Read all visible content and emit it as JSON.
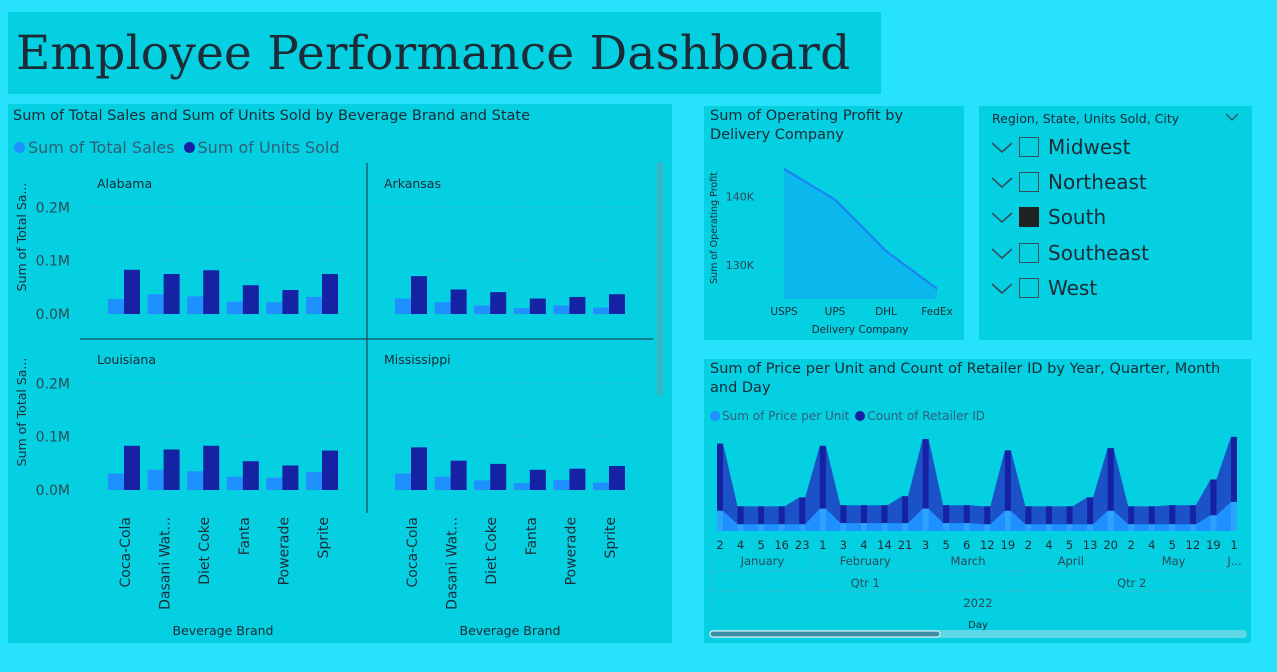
{
  "page": {
    "title": "Employee Performance Dashboard"
  },
  "colors": {
    "background": "#26e2fb",
    "panel": "#04d0e2",
    "total_sales": "#1e90ff",
    "units_sold": "#1422a3",
    "area_fill": "#0bb8ee",
    "area_line": "#1a84f0"
  },
  "small_multiples": {
    "title": "Sum of Total Sales and Sum of Units Sold by Beverage Brand and State",
    "legend": [
      "Sum of Total Sales",
      "Sum of Units Sold"
    ],
    "ylabel": "Sum of Total Sa...",
    "xlabel": "Beverage Brand",
    "x_tick_labels": [
      "Coca-Cola",
      "Dasani Wat...",
      "Diet Coke",
      "Fanta",
      "Powerade",
      "Sprite"
    ],
    "y_tick_labels": [
      "0.0M",
      "0.1M",
      "0.2M"
    ]
  },
  "profit": {
    "title": "Sum of Operating Profit by Delivery Company",
    "ylabel": "Sum of Operating Profit",
    "xlabel": "Delivery Company",
    "y_tick_labels": [
      "140K",
      "130K"
    ]
  },
  "slicer": {
    "header": "Region, State, Units Sold, City",
    "items": [
      {
        "label": "Midwest",
        "checked": false
      },
      {
        "label": "Northeast",
        "checked": false
      },
      {
        "label": "South",
        "checked": true
      },
      {
        "label": "Southeast",
        "checked": false
      },
      {
        "label": "West",
        "checked": false
      }
    ]
  },
  "price": {
    "title": "Sum of Price per Unit and Count of Retailer ID by Year, Quarter, Month and Day",
    "legend": [
      "Sum of Price per Unit",
      "Count of Retailer ID"
    ],
    "day_labels": [
      "2",
      "4",
      "5",
      "16",
      "23",
      "1",
      "3",
      "4",
      "14",
      "21",
      "3",
      "5",
      "6",
      "12",
      "19",
      "2",
      "4",
      "5",
      "13",
      "20",
      "2",
      "4",
      "5",
      "12",
      "19",
      "1"
    ],
    "months": [
      "January",
      "February",
      "March",
      "April",
      "May",
      "J..."
    ],
    "quarters": [
      "Qtr 1",
      "Qtr 2"
    ],
    "year": "2022",
    "axis_title": "Day"
  },
  "chart_data": [
    {
      "type": "bar",
      "title": "Sum of Total Sales and Sum of Units Sold by Beverage Brand and State",
      "xlabel": "Beverage Brand",
      "ylabel": "Sum of Total Sa...",
      "ylim": [
        0,
        0.25
      ],
      "unit": "M",
      "categories": [
        "Coca-Cola",
        "Dasani Wat...",
        "Diet Coke",
        "Fanta",
        "Powerade",
        "Sprite"
      ],
      "grid": true,
      "legend": "top-left",
      "panels": [
        {
          "name": "Alabama",
          "series": [
            {
              "name": "Sum of Total Sales",
              "values": [
                0.028,
                0.037,
                0.033,
                0.023,
                0.022,
                0.032
              ]
            },
            {
              "name": "Sum of Units Sold",
              "values": [
                0.083,
                0.075,
                0.082,
                0.054,
                0.045,
                0.075
              ]
            }
          ]
        },
        {
          "name": "Arkansas",
          "series": [
            {
              "name": "Sum of Total Sales",
              "values": [
                0.029,
                0.022,
                0.016,
                0.011,
                0.016,
                0.012
              ]
            },
            {
              "name": "Sum of Units Sold",
              "values": [
                0.071,
                0.046,
                0.041,
                0.029,
                0.032,
                0.037
              ]
            }
          ]
        },
        {
          "name": "Louisiana",
          "series": [
            {
              "name": "Sum of Total Sales",
              "values": [
                0.031,
                0.038,
                0.035,
                0.025,
                0.023,
                0.034
              ]
            },
            {
              "name": "Sum of Units Sold",
              "values": [
                0.083,
                0.076,
                0.083,
                0.054,
                0.046,
                0.074
              ]
            }
          ]
        },
        {
          "name": "Mississippi",
          "series": [
            {
              "name": "Sum of Total Sales",
              "values": [
                0.031,
                0.025,
                0.018,
                0.013,
                0.019,
                0.014
              ]
            },
            {
              "name": "Sum of Units Sold",
              "values": [
                0.08,
                0.055,
                0.049,
                0.038,
                0.04,
                0.045
              ]
            }
          ]
        }
      ]
    },
    {
      "type": "area",
      "title": "Sum of Operating Profit by Delivery Company",
      "xlabel": "Delivery Company",
      "ylabel": "Sum of Operating Profit",
      "categories": [
        "USPS",
        "UPS",
        "DHL",
        "FedEx"
      ],
      "values": [
        144000,
        139500,
        132000,
        126500
      ],
      "ylim": [
        125000,
        145000
      ],
      "yticks": [
        130000,
        140000
      ],
      "grid": true
    },
    {
      "type": "area",
      "title": "Sum of Price per Unit and Count of Retailer ID by Year, Quarter, Month and Day",
      "xlabel": "Day",
      "legend": "top-left",
      "stacked": true,
      "x": [
        "2",
        "4",
        "5",
        "16",
        "23",
        "1",
        "3",
        "4",
        "14",
        "21",
        "3",
        "5",
        "6",
        "12",
        "19",
        "2",
        "4",
        "5",
        "13",
        "20",
        "2",
        "4",
        "5",
        "12",
        "19",
        "1"
      ],
      "series": [
        {
          "name": "Sum of Price per Unit",
          "values": [
            18,
            6,
            6,
            6,
            6,
            20,
            7,
            7,
            7,
            7,
            20,
            7,
            7,
            6,
            18,
            6,
            6,
            6,
            6,
            18,
            6,
            6,
            6,
            6,
            14,
            26
          ]
        },
        {
          "name": "Count of Retailer ID",
          "values": [
            60,
            16,
            16,
            16,
            24,
            56,
            16,
            16,
            16,
            24,
            62,
            16,
            16,
            16,
            54,
            16,
            16,
            16,
            24,
            56,
            16,
            16,
            17,
            17,
            32,
            58
          ]
        }
      ],
      "ylim": [
        0,
        100
      ]
    }
  ]
}
